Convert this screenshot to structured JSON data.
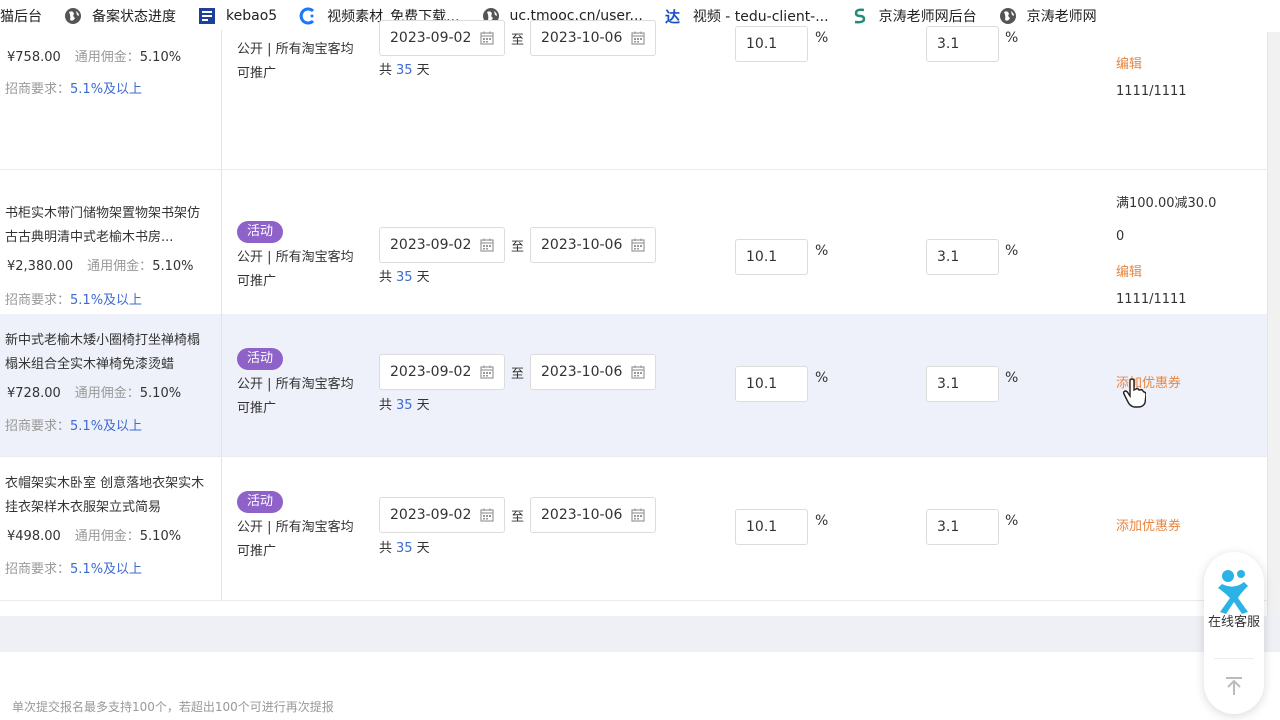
{
  "bookmarks": [
    {
      "label": "猫后台",
      "icon": "none"
    },
    {
      "label": "备案状态进度",
      "icon": "globe-icon"
    },
    {
      "label": "kebao5",
      "icon": "bookmark-app-icon"
    },
    {
      "label": "视频素材_免费下载...",
      "icon": "c-logo-icon"
    },
    {
      "label": "uc.tmooc.cn/user...",
      "icon": "globe-icon"
    },
    {
      "label": "视频 - tedu-client-...",
      "icon": "da-logo-icon"
    },
    {
      "label": "京涛老师网后台",
      "icon": "s-logo-icon"
    },
    {
      "label": "京涛老师网",
      "icon": "globe-icon"
    }
  ],
  "rows": [
    {
      "title": "",
      "price": "¥758.00",
      "commission_label": "通用佣金：",
      "commission": "5.10%",
      "req_label": "招商要求：",
      "req_value": "5.1%及以上",
      "tag": "",
      "scope": "公开 | 所有淘宝客均可推广",
      "start_date": "2023-09-02",
      "end_date": "2023-10-06",
      "to": "至",
      "days_prefix": "共",
      "days": "35",
      "days_suffix": "天",
      "rate1": "10.1",
      "rate2": "3.1",
      "pct": "%",
      "op_lines": [],
      "op_link": "编辑",
      "op_extra": "1111/1111"
    },
    {
      "title": "书柜实木带门储物架置物架书架仿古古典明清中式老榆木书房...",
      "price": "¥2,380.00",
      "commission_label": "通用佣金：",
      "commission": "5.10%",
      "req_label": "招商要求：",
      "req_value": "5.1%及以上",
      "tag": "活动",
      "scope": "公开 | 所有淘宝客均可推广",
      "start_date": "2023-09-02",
      "end_date": "2023-10-06",
      "to": "至",
      "days_prefix": "共",
      "days": "35",
      "days_suffix": "天",
      "rate1": "10.1",
      "rate2": "3.1",
      "pct": "%",
      "op_lines": [
        "满100.00减30.0",
        "0"
      ],
      "op_link": "编辑",
      "op_extra": "1111/1111"
    },
    {
      "title": "新中式老榆木矮小圈椅打坐禅椅榻榻米组合全实木禅椅免漆烫蜡",
      "price": "¥728.00",
      "commission_label": "通用佣金：",
      "commission": "5.10%",
      "req_label": "招商要求：",
      "req_value": "5.1%及以上",
      "tag": "活动",
      "scope": "公开 | 所有淘宝客均可推广",
      "start_date": "2023-09-02",
      "end_date": "2023-10-06",
      "to": "至",
      "days_prefix": "共",
      "days": "35",
      "days_suffix": "天",
      "rate1": "10.1",
      "rate2": "3.1",
      "pct": "%",
      "op_lines": [],
      "op_link": "添加优惠券",
      "op_extra": ""
    },
    {
      "title": "衣帽架实木卧室 创意落地衣架实木挂衣架样木衣服架立式简易",
      "price": "¥498.00",
      "commission_label": "通用佣金：",
      "commission": "5.10%",
      "req_label": "招商要求：",
      "req_value": "5.1%及以上",
      "tag": "活动",
      "scope": "公开 | 所有淘宝客均可推广",
      "start_date": "2023-09-02",
      "end_date": "2023-10-06",
      "to": "至",
      "days_prefix": "共",
      "days": "35",
      "days_suffix": "天",
      "rate1": "10.1",
      "rate2": "3.1",
      "pct": "%",
      "op_lines": [],
      "op_link": "添加优惠券",
      "op_extra": ""
    }
  ],
  "footer_note": "单次提交报名最多支持100个，若超出100个可进行再次提报",
  "service": {
    "label": "在线客服",
    "icon": "customer-service-icon",
    "top_icon": "back-to-top-icon"
  },
  "colors": {
    "accent_link": "#e98640",
    "tag_bg": "#8f62c9",
    "blue_text": "#3d6bd3",
    "hover_row": "#eef1f9"
  }
}
